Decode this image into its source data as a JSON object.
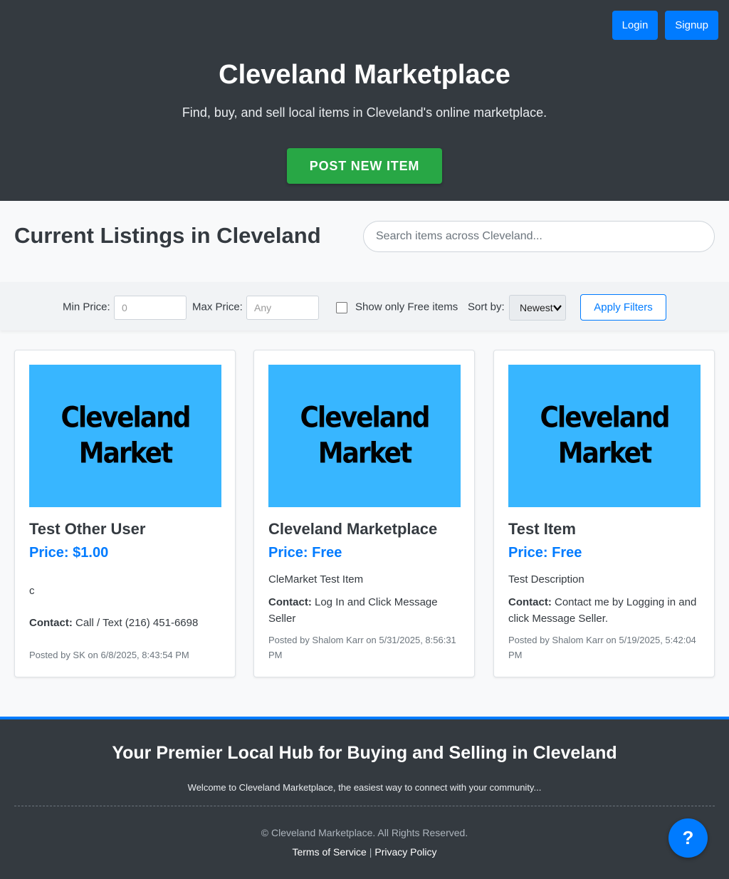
{
  "header": {
    "login_label": "Login",
    "signup_label": "Signup",
    "title": "Cleveland Marketplace",
    "tagline": "Find, buy, and sell local items in Cleveland's online marketplace.",
    "post_button_label": "POST NEW ITEM"
  },
  "listings_section": {
    "heading": "Current Listings in Cleveland",
    "search_placeholder": "Search items across Cleveland..."
  },
  "filters": {
    "min_price_label": "Min Price:",
    "min_price_placeholder": "0",
    "max_price_label": "Max Price:",
    "max_price_placeholder": "Any",
    "free_only_label": "Show only Free items",
    "free_only_checked": false,
    "sort_label": "Sort by:",
    "sort_value": "Newest",
    "apply_label": "Apply Filters"
  },
  "cards": [
    {
      "image_text_line1": "Cleveland",
      "image_text_line2": "Market",
      "title": "Test Other User",
      "price": "Price: $1.00",
      "description": "c",
      "contact_label": "Contact:",
      "contact_value": "Call / Text (216) 451-6698",
      "posted": "Posted by SK on 6/8/2025, 8:43:54 PM"
    },
    {
      "image_text_line1": "Cleveland",
      "image_text_line2": "Market",
      "title": "Cleveland Marketplace",
      "price": "Price: Free",
      "description": "CleMarket Test Item",
      "contact_label": "Contact:",
      "contact_value": "Log In and Click Message Seller",
      "posted": "Posted by Shalom Karr on 5/31/2025, 8:56:31 PM"
    },
    {
      "image_text_line1": "Cleveland",
      "image_text_line2": "Market",
      "title": "Test Item",
      "price": "Price: Free",
      "description": "Test Description",
      "contact_label": "Contact:",
      "contact_value": "Contact me by Logging in and click Message Seller.",
      "posted": "Posted by Shalom Karr on 5/19/2025, 5:42:04 PM"
    }
  ],
  "footer": {
    "heading": "Your Premier Local Hub for Buying and Selling in Cleveland",
    "welcome": "Welcome to Cleveland Marketplace, the easiest way to connect with your community...",
    "copyright": "© Cleveland Marketplace. All Rights Reserved.",
    "terms_label": "Terms of Service",
    "separator": "|",
    "privacy_label": "Privacy Policy"
  },
  "help_button_label": "?",
  "colors": {
    "header_bg": "#343a40",
    "primary": "#007bff",
    "success": "#28a745",
    "image_bg": "#38b6ff"
  }
}
